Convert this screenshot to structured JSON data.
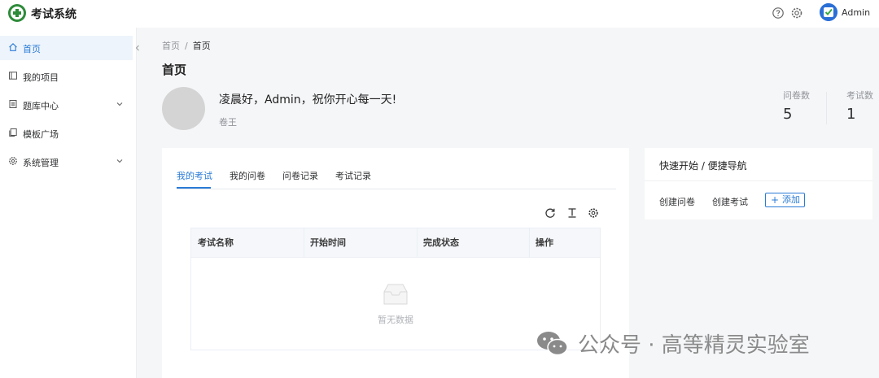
{
  "header": {
    "app_title": "考试系统",
    "user_name": "Admin",
    "icons": [
      "help-icon",
      "gear-icon"
    ]
  },
  "sidebar": {
    "items": [
      {
        "label": "首页",
        "icon": "home-icon",
        "active": true
      },
      {
        "label": "我的项目",
        "icon": "project-icon"
      },
      {
        "label": "题库中心",
        "icon": "question-bank-icon",
        "expandable": true
      },
      {
        "label": "模板广场",
        "icon": "template-icon"
      },
      {
        "label": "系统管理",
        "icon": "gear-icon",
        "expandable": true
      }
    ]
  },
  "breadcrumb": {
    "items": [
      "首页",
      "首页"
    ],
    "separator": "/"
  },
  "page_title": "首页",
  "profile": {
    "greeting": "凌晨好，Admin，祝你开心每一天!",
    "role": "卷王"
  },
  "stats": [
    {
      "label": "问卷数",
      "value": "5"
    },
    {
      "label": "考试数",
      "value": "1"
    }
  ],
  "tabs": [
    "我的考试",
    "我的问卷",
    "问卷记录",
    "考试记录"
  ],
  "active_tab": 0,
  "table": {
    "headers": [
      "考试名称",
      "开始时间",
      "完成状态",
      "操作"
    ],
    "rows": [],
    "empty_text": "暂无数据"
  },
  "quick_nav": {
    "title": "快速开始 / 便捷导航",
    "links": [
      "创建问卷",
      "创建考试"
    ],
    "add_label": "添加"
  },
  "watermark": "公众号 · 高等精灵实验室",
  "colors": {
    "accent": "#2a7bd6",
    "logo": "#2e8b3a",
    "background": "#f5f6f8"
  }
}
